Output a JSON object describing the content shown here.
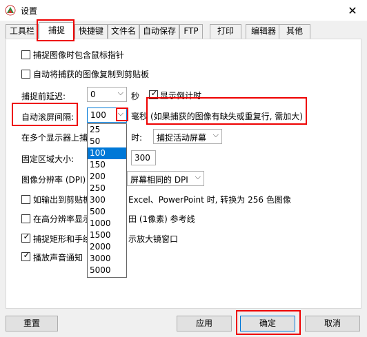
{
  "window": {
    "title": "设置",
    "close_glyph": "✕"
  },
  "tabs": [
    "工具栏",
    "捕捉",
    "快捷键",
    "文件名",
    "自动保存",
    "FTP",
    "打印",
    "编辑器",
    "其他"
  ],
  "options": {
    "include_cursor": "捕捉图像时包含鼠标指针",
    "copy_to_clipboard": "自动将捕获的图像复制到剪贴板",
    "delay_label": "捕捉前延迟:",
    "delay_value": "0",
    "delay_unit": "秒",
    "show_countdown": "显示倒计时",
    "scroll_label": "自动滚屏间隔:",
    "scroll_value": "100",
    "scroll_unit": "毫秒",
    "scroll_hint": "(如果捕获的图像有缺失或重复行, 需加大)",
    "multi_display_label_a": "在多个显示器上捕",
    "multi_display_label_b": "时:",
    "multi_display_value": "捕捉活动屏幕",
    "fixed_region_label": "固定区域大小:",
    "fixed_region_value": "300",
    "dpi_label": "图像分辨率 (DPI)",
    "dpi_value": "屏幕相同的 DPI",
    "output_clipboard_a": "如输出到剪贴板",
    "output_clipboard_b": "Excel、PowerPoint 时, 转换为 256 色图像",
    "high_res_a": "在高分辨率显示",
    "high_res_b": "田 (1像素) 参考线",
    "capture_rect_a": "捕捉矩形和手绘",
    "capture_rect_b": "示放大镜窗口",
    "play_sound": "播放声音通知"
  },
  "dropdown_options": [
    "25",
    "50",
    "100",
    "150",
    "200",
    "250",
    "300",
    "500",
    "1000",
    "1500",
    "2000",
    "3000",
    "5000"
  ],
  "buttons": {
    "reset": "重置",
    "apply": "应用",
    "ok": "确定",
    "cancel": "取消"
  },
  "colors": {
    "accent": "#0078d7",
    "annotation": "#e00000"
  }
}
